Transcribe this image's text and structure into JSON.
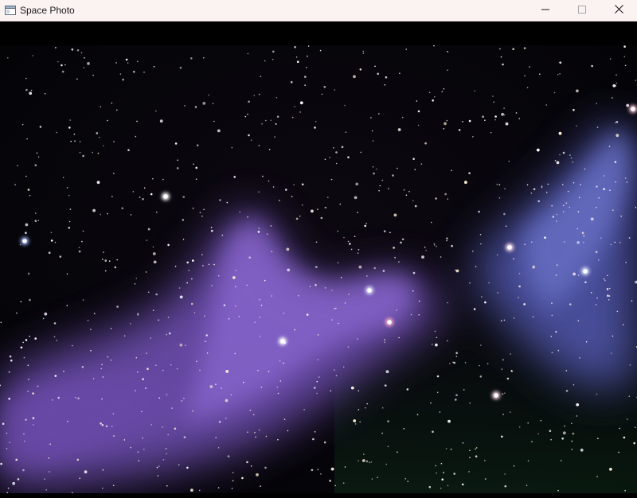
{
  "window": {
    "title": "Space Photo",
    "icon": "app-window-icon"
  },
  "controls": {
    "minimize_icon": "minimize-icon",
    "maximize_icon": "maximize-icon",
    "close_icon": "close-icon"
  },
  "image": {
    "subject": "nebula-starfield",
    "colors": {
      "nebula": "#7b5fc0",
      "nebula_right": "#5f6ab8",
      "background": "#000000",
      "titlebar": "#fbf3f1"
    }
  }
}
